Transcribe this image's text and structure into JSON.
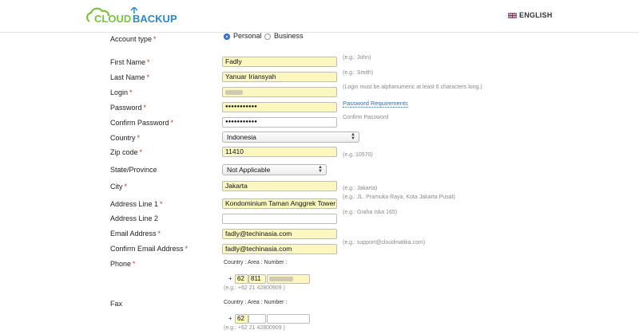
{
  "header": {
    "logo_text_left": "CLOUD",
    "logo_text_right": "BACKUP",
    "language": "ENGLISH",
    "language_flag": "uk-flag-icon"
  },
  "form": {
    "required_marker": "*",
    "account_type": {
      "label": "Account type",
      "options": [
        "Personal",
        "Business"
      ],
      "selected": "Personal"
    },
    "first_name": {
      "label": "First Name",
      "value": "Fadly",
      "hint": "(e.g.: John)"
    },
    "last_name": {
      "label": "Last Name",
      "value": "Yanuar Iriansyah",
      "hint": "(e.g.: Smith)"
    },
    "login": {
      "label": "Login",
      "hint": "(Login must be alphanumeric at least 6 characters long.)"
    },
    "password": {
      "label": "Password",
      "value": "●●●●●●●●●●●",
      "link": "Password Requirements"
    },
    "confirm_password": {
      "label": "Confirm Password",
      "value": "●●●●●●●●●●●",
      "hint": "Confirm Password"
    },
    "country": {
      "label": "Country",
      "value": "Indonesia"
    },
    "zip": {
      "label": "Zip code",
      "value": "11410",
      "hint": "(e.g.:10570)"
    },
    "state": {
      "label": "State/Province",
      "value": "Not Applicable"
    },
    "city": {
      "label": "City",
      "value": "Jakarta",
      "hint": "(e.g.: Jakarta)"
    },
    "address1": {
      "label": "Address Line 1",
      "value": "Kondominium Taman Anggrek Tower",
      "hint": "(e.g.: JL. Pramuka Raya, Kota Jakarta Pusat)"
    },
    "address2": {
      "label": "Address Line 2",
      "value": "",
      "hint": "(e.g.: Graha Iska 165)"
    },
    "email": {
      "label": "Email Address",
      "value": "fadly@techinasia.com"
    },
    "confirm_email": {
      "label": "Confirm Email Address",
      "value": "fadly@techinasia.com",
      "hint": "(e.g.: support@cloudmatika.com)"
    },
    "phone": {
      "label": "Phone",
      "columns": "Country : Area : Number :",
      "plus": "+",
      "country_code": "62",
      "area": "811",
      "example": "(e.g.: +62 21 42800909 )"
    },
    "fax": {
      "label": "Fax",
      "columns": "Country : Area : Number :",
      "plus": "+",
      "country_code": "62",
      "area": "",
      "example": "(e.g.: +62 21 42800909 )"
    }
  },
  "colors": {
    "field_fill": "#fbf7c1",
    "required": "#c0392b",
    "link": "#2f6fb5",
    "logo_green": "#7cc242",
    "logo_blue": "#2e88c9"
  }
}
